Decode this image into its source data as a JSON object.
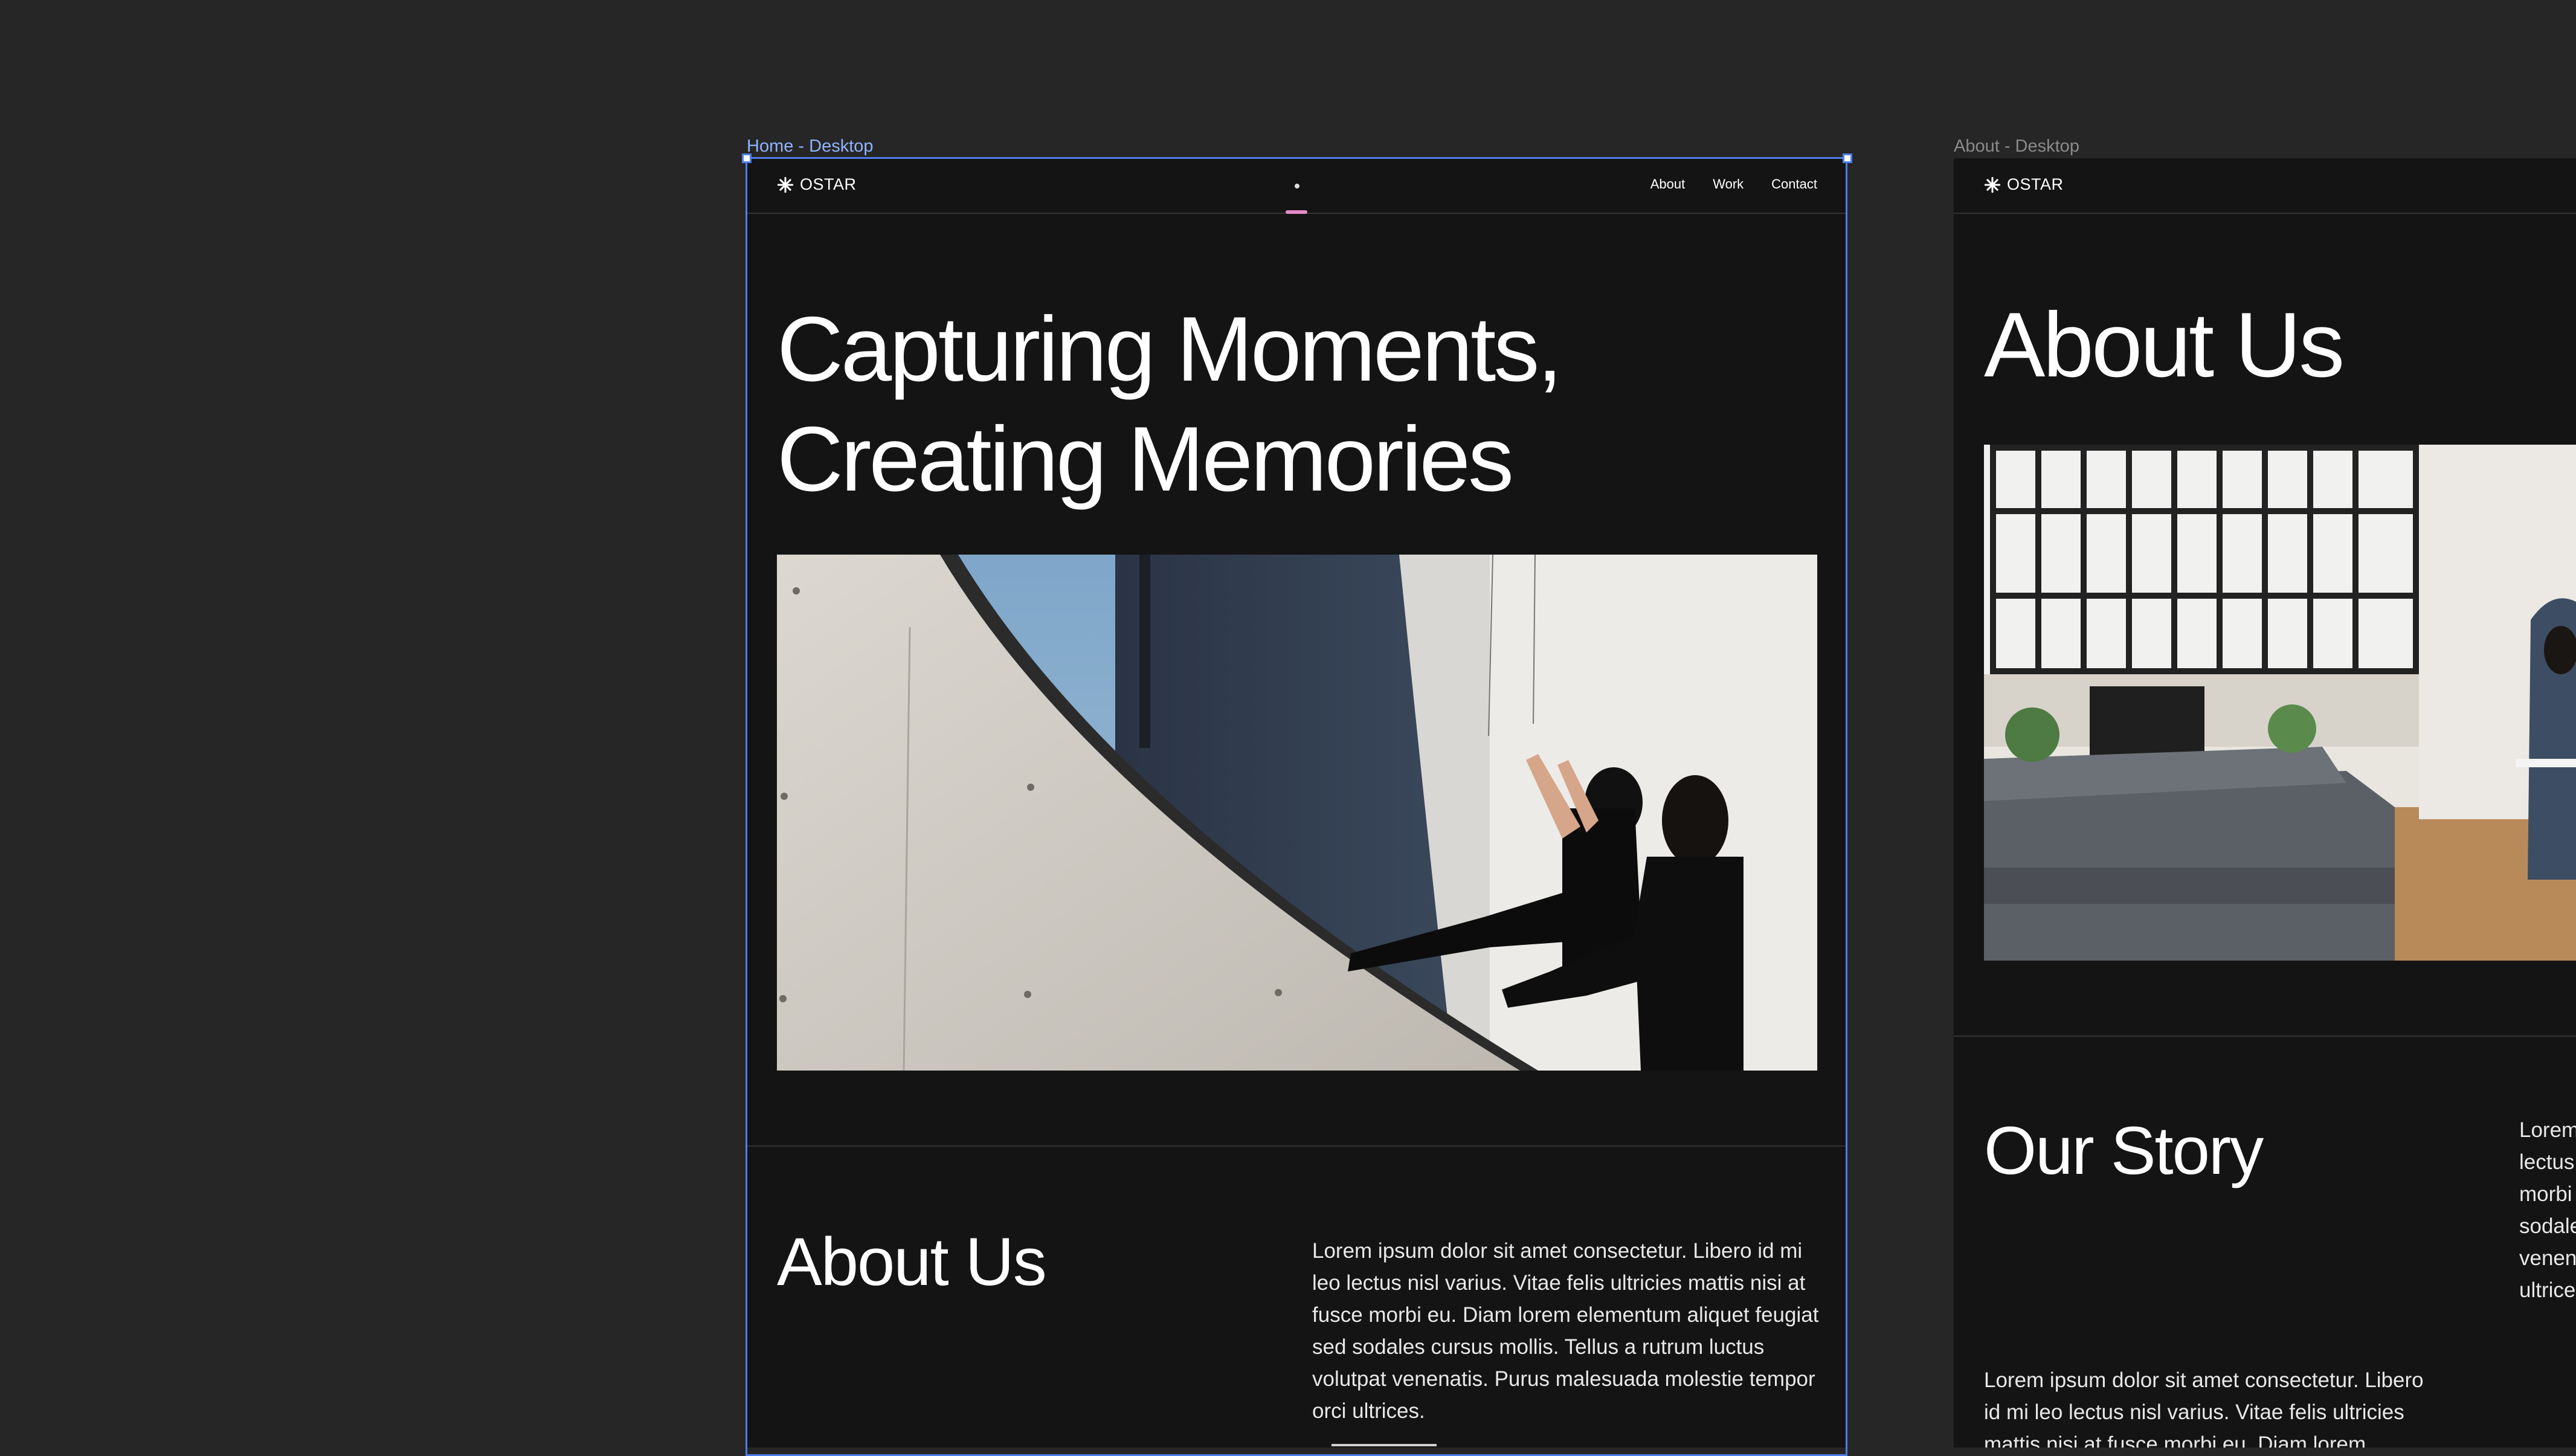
{
  "canvas": {
    "background": "#262626",
    "selection_color": "#4d7ee8"
  },
  "home_frame": {
    "label": "Home - Desktop",
    "selected": true,
    "nav": {
      "logo_icon": "asterisk-icon",
      "logo_text": "OSTAR",
      "links": [
        "About",
        "Work",
        "Contact"
      ]
    },
    "hero": {
      "title_line1": "Capturing Moments,",
      "title_line2": "Creating Memories",
      "image_alt": "Two dancers in black climbing a curved concrete wall"
    },
    "about": {
      "title": "About Us",
      "text": "Lorem ipsum dolor sit amet consectetur. Libero id mi leo lectus nisl varius. Vitae felis ultricies mattis nisi at fusce morbi eu. Diam lorem elementum aliquet feugiat sed sodales cursus mollis. Tellus a rutrum luctus volutpat venenatis. Purus malesuada molestie tempor orci ultrices."
    }
  },
  "about_frame": {
    "label": "About - Desktop",
    "selected": false,
    "nav": {
      "logo_icon": "asterisk-icon",
      "logo_text": "OSTAR"
    },
    "title": "About Us",
    "image_alt": "Bright loft interior with grey sofa and large windows",
    "story": {
      "title": "Our Story",
      "side_text_fragments": [
        "Lorem",
        "lectus",
        "morbi",
        "sodale",
        "venen",
        "ultrice"
      ],
      "text": "Lorem ipsum dolor sit amet consectetur. Libero id mi leo lectus nisl varius. Vitae felis ultricies mattis nisi at fusce morbi eu. Diam lorem elementum"
    }
  }
}
